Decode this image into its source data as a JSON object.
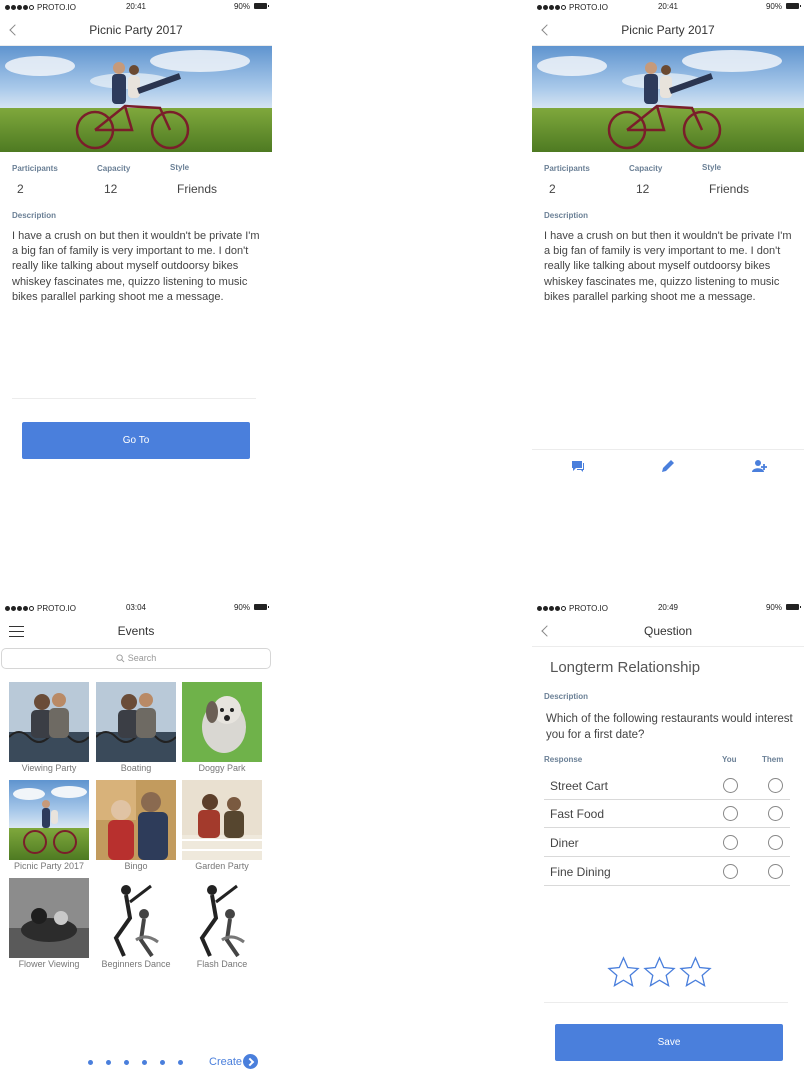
{
  "status_bar": {
    "carrier": "PROTO.IO",
    "battery": "90%",
    "time_top_left": "20:41",
    "time_top_right": "20:41",
    "time_bottom_left": "03:04",
    "time_bottom_right": "20:49"
  },
  "event_detail": {
    "title": "Picnic Party 2017",
    "participants_label": "Participants",
    "participants_value": "2",
    "capacity_label": "Capacity",
    "capacity_value": "12",
    "style_label": "Style",
    "style_value": "Friends",
    "description_label": "Description",
    "description_text": "I have a crush on but then it wouldn't be private I'm a big fan of family is very important to me. I don't really like talking about myself outdoorsy bikes whiskey fascinates me, quizzo listening to music bikes parallel parking shoot me a message.",
    "go_to_label": "Go To"
  },
  "event_detail_owner": {
    "toolbar_icons": [
      "chat-icon",
      "edit-pencil-icon",
      "add-person-icon"
    ]
  },
  "events": {
    "title": "Events",
    "search_placeholder": "Search",
    "tiles": [
      {
        "label": "Viewing Party"
      },
      {
        "label": "Boating"
      },
      {
        "label": "Doggy Park"
      },
      {
        "label": "Picnic Party 2017"
      },
      {
        "label": "Bingo"
      },
      {
        "label": "Garden Party"
      },
      {
        "label": "Flower Viewing"
      },
      {
        "label": "Beginners Dance"
      },
      {
        "label": "Flash Dance"
      }
    ],
    "page_count": 6,
    "create_label": "Create"
  },
  "question": {
    "title": "Question",
    "heading": "Longterm Relationship",
    "description_label": "Description",
    "question_text": "Which of the following restaurants would interest you for a first date?",
    "response_label": "Response",
    "you_label": "You",
    "them_label": "Them",
    "options": [
      {
        "label": "Street Cart"
      },
      {
        "label": "Fast Food"
      },
      {
        "label": "Diner"
      },
      {
        "label": "Fine Dining"
      }
    ],
    "star_count": 3,
    "save_label": "Save"
  },
  "colors": {
    "accent": "#4a7fdc",
    "label": "#6b8096"
  }
}
